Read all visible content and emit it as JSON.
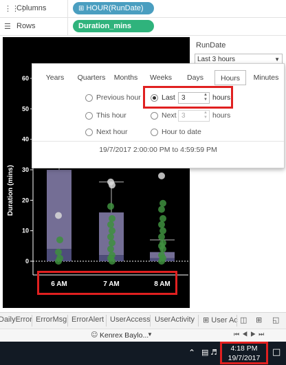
{
  "shelves": {
    "columns_label": "Columns",
    "columns_pill": "HOUR(RunDate)",
    "rows_label": "Rows",
    "rows_pill": "Duration_mins"
  },
  "filter": {
    "title": "RunDate",
    "selected": "Last 3 hours"
  },
  "popup": {
    "tabs": [
      "Years",
      "Quarters",
      "Months",
      "Weeks",
      "Days",
      "Hours",
      "Minutes"
    ],
    "active_tab": "Hours",
    "options": {
      "previous": "Previous hour",
      "this": "This hour",
      "next_single": "Next hour",
      "last": "Last",
      "last_value": "3",
      "last_unit": "hours",
      "next": "Next",
      "next_value": "3",
      "next_unit": "hours",
      "to_date": "Hour to date"
    },
    "range_text": "19/7/2017 2:00:00 PM to 4:59:59 PM"
  },
  "chart_data": {
    "type": "scatter",
    "ylabel": "Duration (mins)",
    "yticks": [
      "60",
      "50",
      "40",
      "30",
      "20",
      "10",
      "0"
    ],
    "ylim": [
      -3,
      63
    ],
    "categories": [
      "6 AM",
      "7 AM",
      "8 AM"
    ],
    "boxes": [
      {
        "category": "6 AM",
        "whisker_high": 58,
        "q3": 30,
        "median": 4,
        "q1": 0,
        "whisker_low": 0
      },
      {
        "category": "7 AM",
        "whisker_high": 26,
        "q3": 16,
        "median": 2,
        "q1": 0,
        "whisker_low": 0
      },
      {
        "category": "8 AM",
        "whisker_high": 7,
        "q3": 3,
        "median": 1,
        "q1": 0,
        "whisker_low": 0
      }
    ],
    "points": [
      {
        "category": "6 AM",
        "values": [
          15,
          7,
          3,
          1,
          0
        ]
      },
      {
        "category": "7 AM",
        "values": [
          26,
          25,
          18,
          14,
          12,
          10,
          8,
          6,
          4,
          2,
          1,
          0
        ]
      },
      {
        "category": "8 AM",
        "values": [
          28,
          19,
          17,
          14,
          12,
          10,
          8,
          6,
          5,
          4,
          2,
          1,
          0
        ]
      }
    ],
    "grid": false,
    "colors": {
      "background": "#000000",
      "box": "#9b93c7",
      "point_green": "#3e8f3e",
      "point_grey": "#d8d8d8"
    }
  },
  "sheets": [
    "DailyError",
    "ErrorMsg",
    "ErrorAlert",
    "UserAccess",
    "UserActivity",
    "User Ac"
  ],
  "status": {
    "user": "Kenrex Baylo..."
  },
  "taskbar": {
    "time": "4:18 PM",
    "date": "19/7/2017"
  },
  "colors": {
    "pill_blue": "#4a9ec0",
    "pill_green": "#2fb37c",
    "highlight": "#e02020"
  }
}
